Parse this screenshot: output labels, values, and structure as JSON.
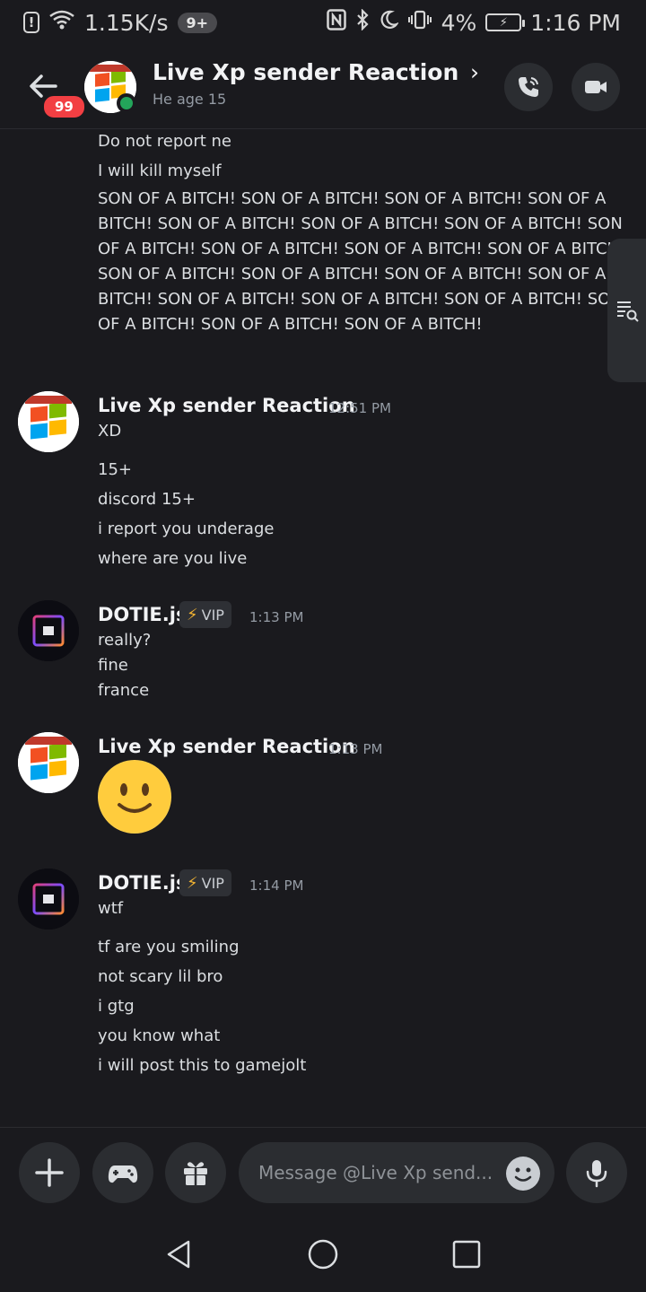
{
  "status_bar": {
    "speed": "1.15K/s",
    "notif_count": "9+",
    "battery": "4%",
    "time": "1:16 PM"
  },
  "header": {
    "back_badge": "99",
    "title": "Live Xp sender Reaction",
    "chevron": "›",
    "subtitle": "He age 15"
  },
  "messages": {
    "top_lines": [
      "Do not report ne",
      "I will kill myself"
    ],
    "top_paragraph": "SON OF A BITCH! SON OF A BITCH! SON OF A BITCH! SON OF A BITCH! SON OF A BITCH! SON OF A BITCH! SON OF A BITCH! SON OF A BITCH! SON OF A BITCH! SON OF A BITCH! SON OF A BITCH! SON OF A BITCH! SON OF A BITCH! SON OF A BITCH! SON OF A BITCH! SON OF A BITCH! SON OF A BITCH! SON OF A BITCH! SON OF A BITCH! SON OF A BITCH! SON OF A BITCH!",
    "groups": [
      {
        "author": "Live Xp sender Reaction",
        "time": "12:51 PM",
        "lines": [
          "XD",
          "15+",
          "discord 15+",
          "i report you underage",
          "where are you live"
        ]
      },
      {
        "author": "DOTIE.js",
        "tag": "VIP",
        "time": "1:13 PM",
        "lines": [
          "really?",
          "fine",
          "france"
        ]
      },
      {
        "author": "Live Xp sender Reaction",
        "time": "1:13 PM",
        "emoji": "slightly-smiling-face"
      },
      {
        "author": "DOTIE.js",
        "tag": "VIP",
        "time": "1:14 PM",
        "lines": [
          "wtf",
          "tf are you smiling",
          "not scary lil bro",
          "i gtg",
          "you know what",
          "i will post this to gamejolt"
        ]
      }
    ]
  },
  "composer": {
    "placeholder": "Message @Live Xp send..."
  },
  "colors": {
    "background": "#1a1a1e",
    "online": "#23a55a",
    "badge": "#f23f43",
    "vip_bolt": "#f0b232"
  }
}
